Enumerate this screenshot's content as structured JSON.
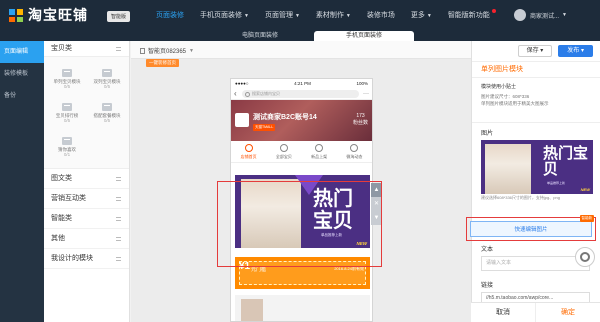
{
  "app": {
    "title": "淘宝旺铺",
    "edition": "智能版",
    "user": "商家测试..."
  },
  "nav": [
    {
      "label": "页面装修",
      "active": true,
      "caret": false
    },
    {
      "label": "手机页面装修",
      "active": false,
      "caret": true
    },
    {
      "label": "页面管理",
      "active": false,
      "caret": true
    },
    {
      "label": "素材制作",
      "active": false,
      "caret": true
    },
    {
      "label": "装修市场",
      "active": false,
      "caret": false
    },
    {
      "label": "更多",
      "active": false,
      "caret": true
    },
    {
      "label": "智能版新功能",
      "active": false,
      "caret": false,
      "badge": true
    }
  ],
  "tabs": {
    "pc": "电脑页面装修",
    "mobile": "手机页面装修"
  },
  "left_nav": [
    {
      "label": "页面编辑",
      "active": true
    },
    {
      "label": "装修模板",
      "active": false
    },
    {
      "label": "备份",
      "active": false
    }
  ],
  "modules": {
    "header": "宝贝类",
    "tiles": [
      {
        "label": "单列宝贝模块",
        "count": "0/5"
      },
      {
        "label": "双列宝贝模块",
        "count": "0/5"
      },
      {
        "label": "宝贝排行榜",
        "count": "0/5"
      },
      {
        "label": "搭配套餐模块",
        "count": "0/5"
      },
      {
        "label": "猜你喜欢",
        "count": "0/1"
      }
    ],
    "rows": [
      "图文类",
      "营销互动类",
      "智能类",
      "其他",
      "我设计的模块"
    ]
  },
  "canvas": {
    "page_selector": "智能页082365",
    "badge": "一键装修首页",
    "phone": {
      "carrier": "●●●●○",
      "time": "4:21 PM",
      "battery": "100%",
      "search_placeholder": "搜索店铺内宝贝",
      "shop_name": "测试商家B2C账号14",
      "shop_tag": "天猫TMALL",
      "fans_count": "173",
      "fans_label": "粉丝数",
      "shop_nav": [
        "店铺首页",
        "全部宝贝",
        "新品上架",
        "微淘动态"
      ],
      "hero_text": "热门宝贝",
      "hero_sub": "单品推荐上新",
      "hero_new": "NEW",
      "ticket_num": "¥1",
      "ticket_unit": "元门槛",
      "ticket_date": "2016.8.24前有效"
    }
  },
  "right_panel": {
    "save": "保存",
    "publish": "发布",
    "title": "单列图片模块",
    "tips_title": "模块使用小贴士",
    "tips_lines": [
      "图片建议尺寸：608*336",
      "单列图片模块适用于精美大图展示"
    ],
    "image_label": "图片",
    "image_hint": "建议选择608*336尺寸的图片，支持jpg、png",
    "edit_button": "快速编辑图片",
    "edit_tag": "智能新",
    "text_label": "文本",
    "text_placeholder": "请输入文本",
    "link_label": "链接",
    "link_value": "//h5.m.taobao.com/awp/core...",
    "cancel": "取消",
    "ok": "确定"
  },
  "colors": {
    "topbar": "#1d2b3a",
    "accent_blue": "#2b7de9",
    "accent_orange": "#ff6a00",
    "hero_purple": "#4b2f83",
    "selection_red": "#e43c3c"
  }
}
